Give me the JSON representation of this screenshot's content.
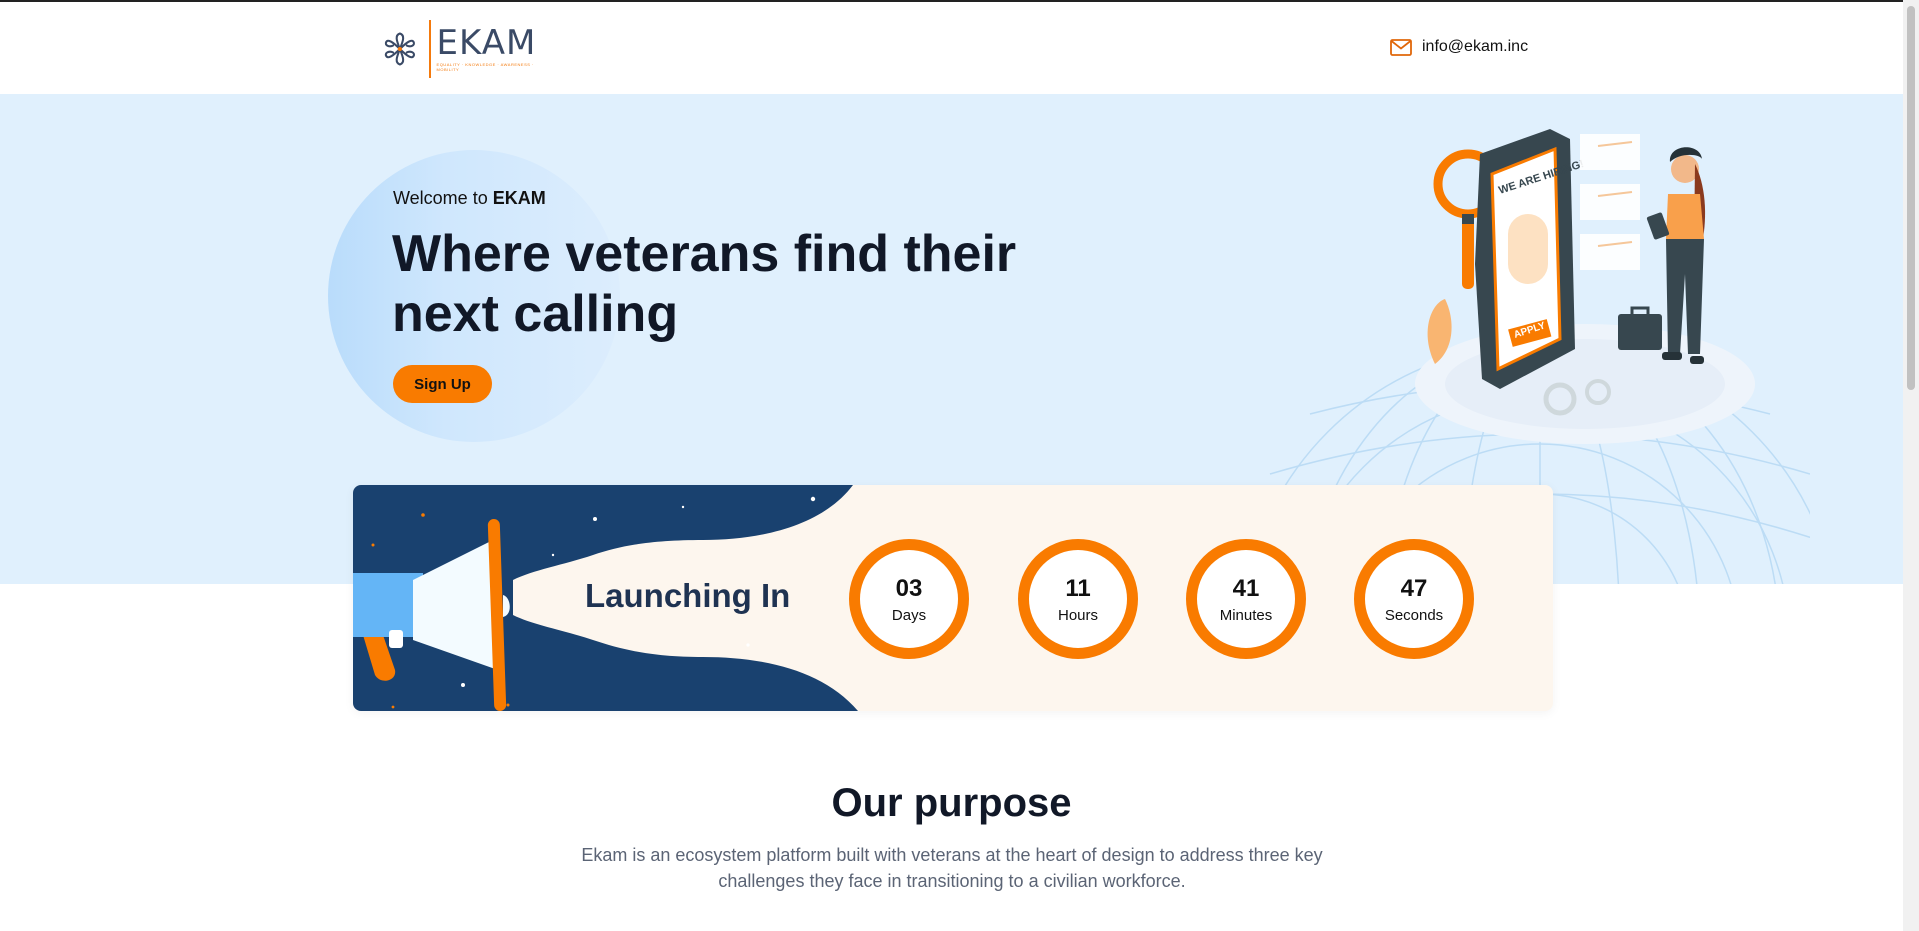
{
  "header": {
    "logo_word": "EKAM",
    "logo_tagline": "EQUALITY · KNOWLEDGE · AWARENESS · MOBILITY",
    "email_icon": "mail-icon",
    "email": "info@ekam.inc"
  },
  "hero": {
    "welcome_prefix": "Welcome to ",
    "welcome_brand": "EKAM",
    "title": "Where veterans find their next calling",
    "signup_label": "Sign Up",
    "illustration_text": {
      "sign": "WE ARE HIRING!",
      "apply": "APPLY"
    }
  },
  "countdown": {
    "label": "Launching In",
    "units": [
      {
        "value": "03",
        "label": "Days"
      },
      {
        "value": "11",
        "label": "Hours"
      },
      {
        "value": "41",
        "label": "Minutes"
      },
      {
        "value": "47",
        "label": "Seconds"
      }
    ]
  },
  "purpose": {
    "title": "Our purpose",
    "text": "Ekam is an ecosystem platform built with veterans at the heart of design to address three key challenges they face in transitioning to a civilian workforce."
  },
  "colors": {
    "accent": "#f97b00",
    "hero_bg": "#e0f0fd",
    "navy": "#1a3e6e",
    "card_bg": "#fdf6ee"
  }
}
